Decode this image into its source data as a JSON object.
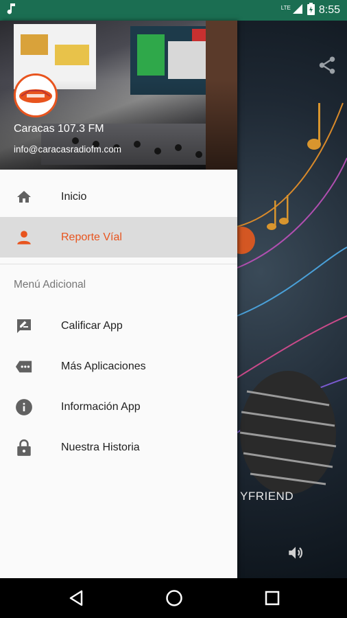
{
  "status_bar": {
    "network": "LTE",
    "time": "8:55",
    "icons": [
      "music-note-icon",
      "signal-icon",
      "battery-icon"
    ]
  },
  "background_app": {
    "song_text": "YFRIEND",
    "icons": [
      "share-icon",
      "volume-icon"
    ]
  },
  "drawer": {
    "header": {
      "title": "Caracas 107.3 FM",
      "email": "info@caracasradiofm.com"
    },
    "items": [
      {
        "label": "Inicio",
        "icon": "home-icon"
      },
      {
        "label": "Reporte Víal",
        "icon": "person-icon",
        "active": true
      }
    ],
    "section_title": "Menú Adicional",
    "extra_items": [
      {
        "label": "Calificar App",
        "icon": "rate-review-icon"
      },
      {
        "label": "Más Aplicaciones",
        "icon": "more-apps-icon"
      },
      {
        "label": "Información App",
        "icon": "info-icon"
      },
      {
        "label": "Nuestra Historia",
        "icon": "lock-icon"
      }
    ]
  },
  "colors": {
    "status_bar": "#1b6e52",
    "accent": "#e8541e",
    "active_item_bg": "#dcdcdc"
  },
  "nav_bar": {
    "icons": [
      "back-icon",
      "home-circle-icon",
      "recents-icon"
    ]
  }
}
